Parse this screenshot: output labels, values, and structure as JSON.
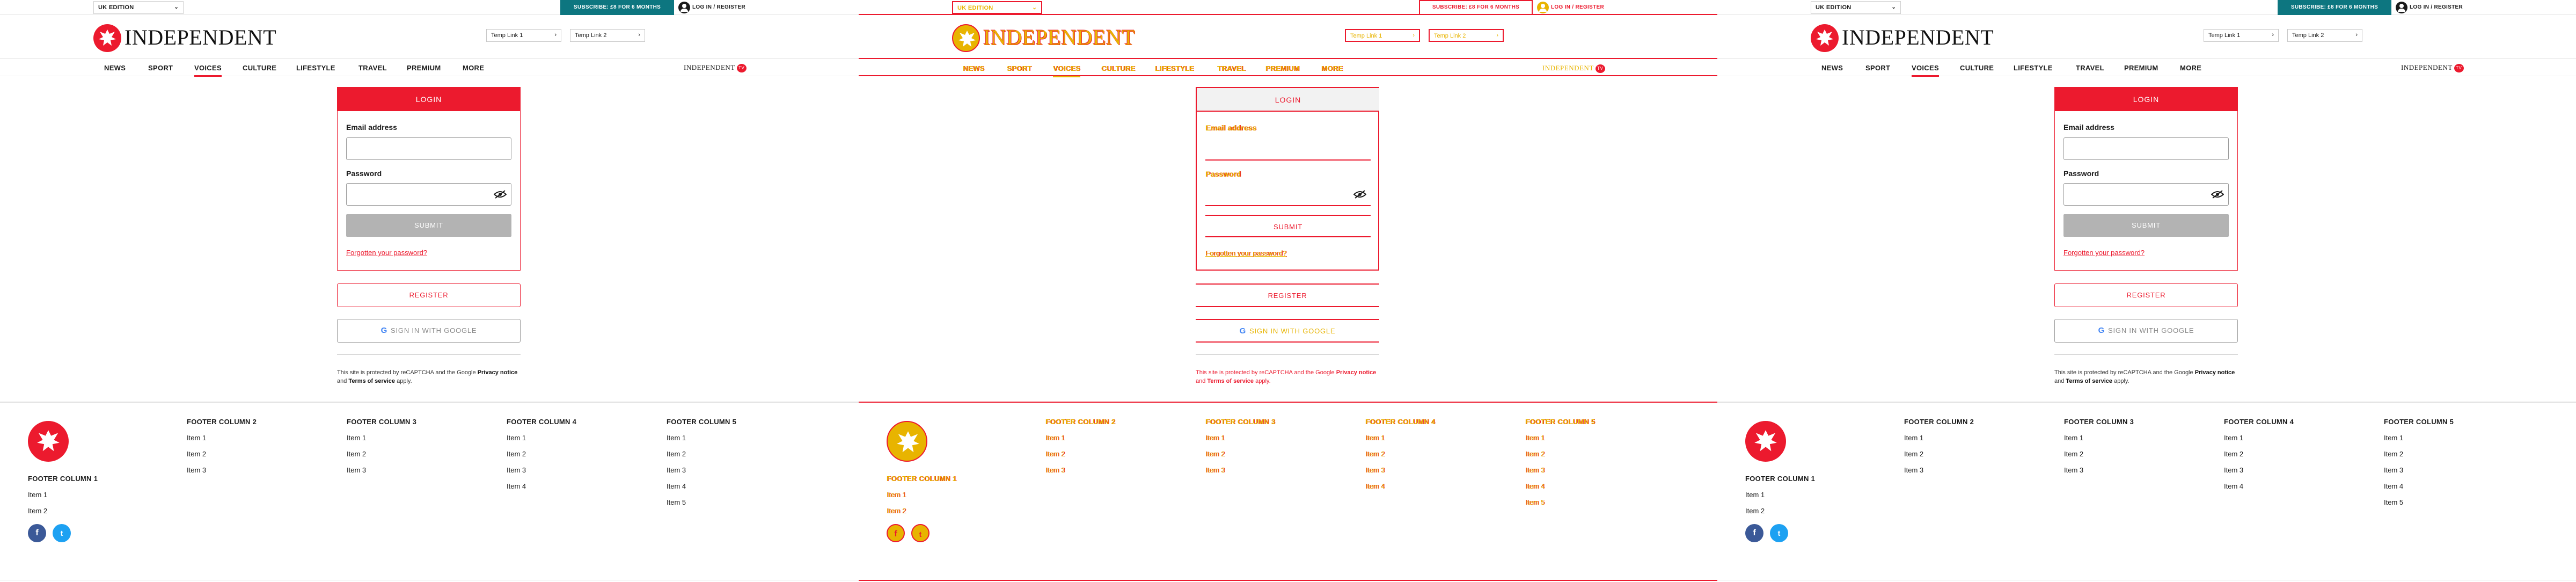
{
  "colors": {
    "brand_red": "#ec1a2e",
    "subscribe_teal": "#0d7680",
    "debug_yellow": "#e8b400",
    "submit_grey": "#b3b3b3"
  },
  "topbar": {
    "edition": "UK EDITION",
    "subscribe": "SUBSCRIBE: £8 FOR 6 MONTHS",
    "login": "LOG IN / REGISTER"
  },
  "masthead": {
    "logo_text": "INDEPENDENT",
    "temp_link_1": "Temp Link 1",
    "temp_link_2": "Temp Link 2"
  },
  "nav": {
    "items": [
      "NEWS",
      "SPORT",
      "VOICES",
      "CULTURE",
      "LIFESTYLE",
      "TRAVEL",
      "PREMIUM",
      "MORE"
    ],
    "active": "VOICES",
    "tv_label": "INDEPENDENT",
    "tv_badge": "TV"
  },
  "login": {
    "title": "LOGIN",
    "email_label": "Email address",
    "password_label": "Password",
    "submit": "SUBMIT",
    "forgot": "Forgotten your password?",
    "register": "REGISTER",
    "google": "SIGN IN WITH GOOGLE",
    "recaptcha_pre": "This site is protected by reCAPTCHA and the Google ",
    "privacy": "Privacy notice",
    "recaptcha_mid": " and ",
    "terms": "Terms of service",
    "recaptcha_post": " apply."
  },
  "footer": {
    "columns": [
      {
        "title": "FOOTER COLUMN 1",
        "items": [
          "Item 1",
          "Item 2"
        ]
      },
      {
        "title": "FOOTER COLUMN 2",
        "items": [
          "Item 1",
          "Item 2",
          "Item 3"
        ]
      },
      {
        "title": "FOOTER COLUMN 3",
        "items": [
          "Item 1",
          "Item 2",
          "Item 3"
        ]
      },
      {
        "title": "FOOTER COLUMN 4",
        "items": [
          "Item 1",
          "Item 2",
          "Item 3",
          "Item 4"
        ]
      },
      {
        "title": "FOOTER COLUMN 5",
        "items": [
          "Item 1",
          "Item 2",
          "Item 3",
          "Item 4",
          "Item 5"
        ]
      }
    ],
    "social": [
      {
        "icon": "facebook-icon",
        "glyph": "f"
      },
      {
        "icon": "twitter-icon",
        "glyph": "t"
      }
    ]
  }
}
